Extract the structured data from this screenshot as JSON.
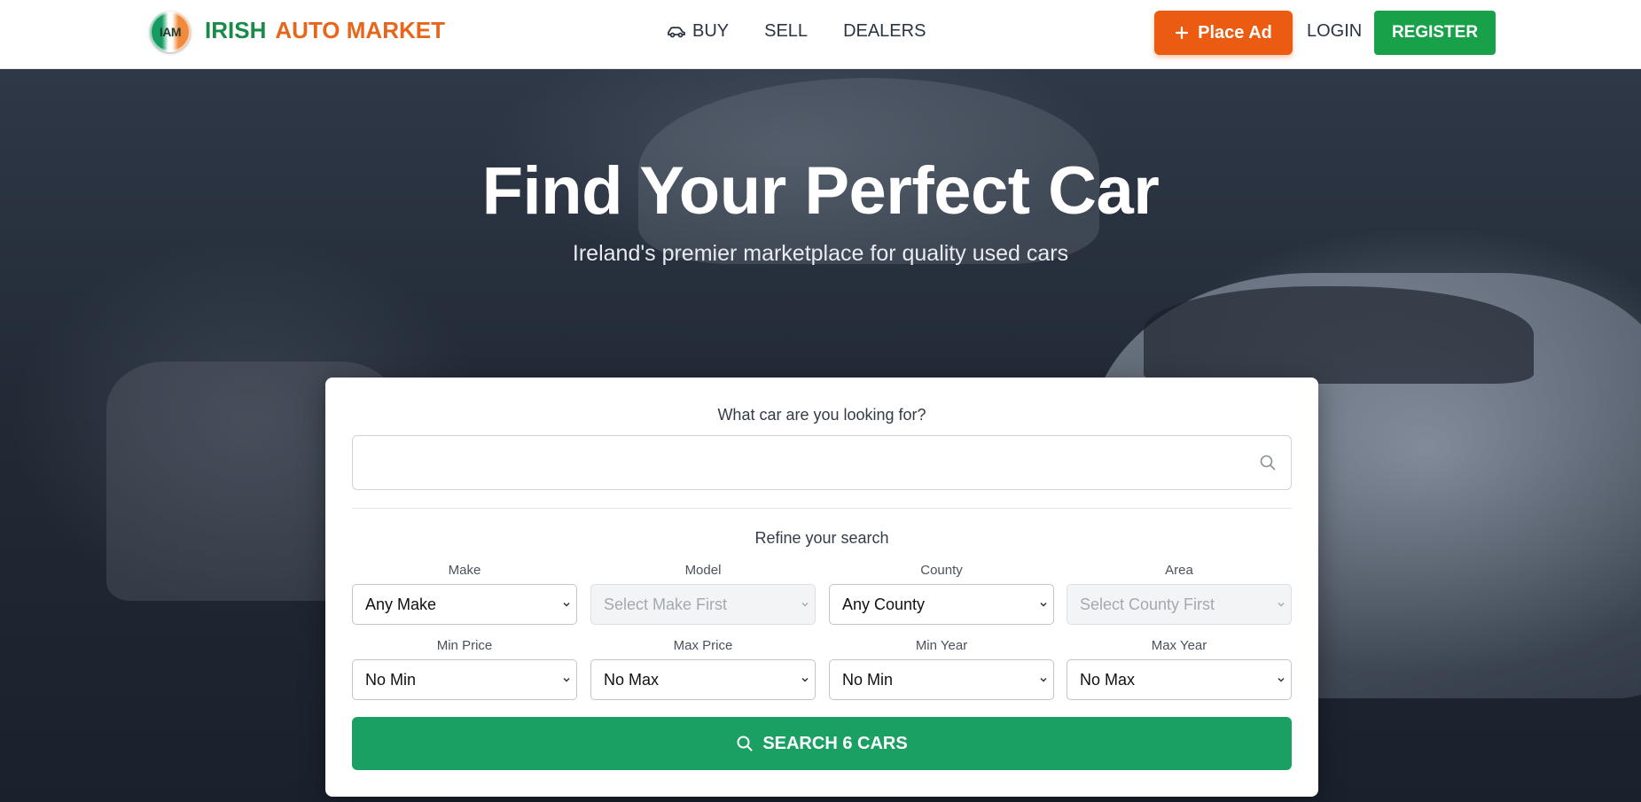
{
  "colors": {
    "brand_green": "#1a8a48",
    "brand_orange": "#e8661c",
    "place_ad": "#ec5b12",
    "register": "#19a14a",
    "search_button": "#1ba064"
  },
  "header": {
    "logo_badge": "IAM",
    "brand_part1": "IRISH",
    "brand_part2": "AUTO MARKET",
    "nav": [
      {
        "label": "BUY",
        "icon": "car-icon"
      },
      {
        "label": "SELL"
      },
      {
        "label": "DEALERS"
      }
    ],
    "place_ad": {
      "label": "Place Ad",
      "icon": "plus-icon"
    },
    "login": "LOGIN",
    "register": "REGISTER"
  },
  "hero": {
    "title": "Find Your Perfect Car",
    "subtitle": "Ireland's premier marketplace for quality used cars"
  },
  "search": {
    "question": "What car are you looking for?",
    "input_value": "",
    "input_placeholder": "",
    "refine_title": "Refine your search",
    "filters": [
      {
        "label": "Make",
        "value": "Any Make",
        "disabled": false
      },
      {
        "label": "Model",
        "value": "Select Make First",
        "disabled": true
      },
      {
        "label": "County",
        "value": "Any County",
        "disabled": false
      },
      {
        "label": "Area",
        "value": "Select County First",
        "disabled": true
      },
      {
        "label": "Min Price",
        "value": "No Min",
        "disabled": false
      },
      {
        "label": "Max Price",
        "value": "No Max",
        "disabled": false
      },
      {
        "label": "Min Year",
        "value": "No Min",
        "disabled": false
      },
      {
        "label": "Max Year",
        "value": "No Max",
        "disabled": false
      }
    ],
    "button_label": "SEARCH 6 CARS"
  }
}
